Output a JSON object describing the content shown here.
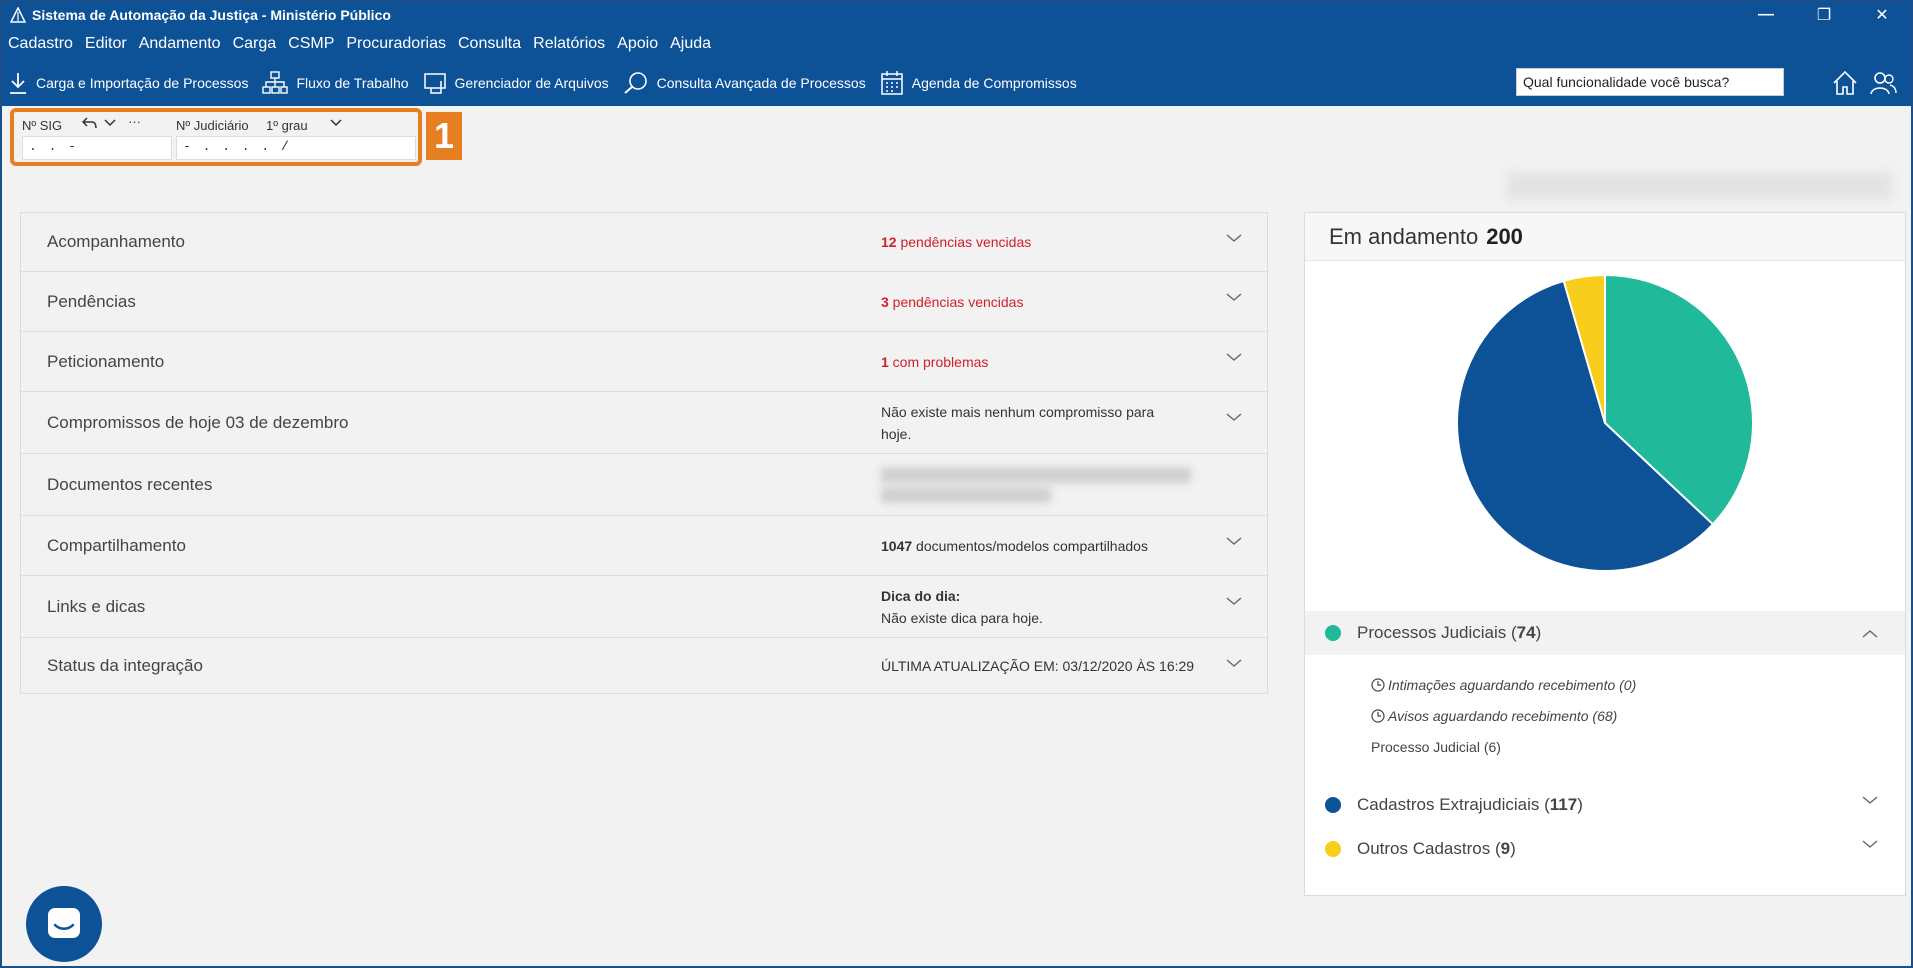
{
  "window": {
    "title": "Sistema de Automação da Justiça - Ministério Público",
    "controls": [
      "minimize",
      "restore",
      "close"
    ]
  },
  "menu": [
    "Cadastro",
    "Editor",
    "Andamento",
    "Carga",
    "CSMP",
    "Procuradorias",
    "Consulta",
    "Relatórios",
    "Apoio",
    "Ajuda"
  ],
  "toolbar": {
    "items": [
      {
        "label": "Carga e Importação de Processos",
        "icon": "download-icon"
      },
      {
        "label": "Fluxo de Trabalho",
        "icon": "workflow-icon"
      },
      {
        "label": "Gerenciador de Arquivos",
        "icon": "file-manager-icon"
      },
      {
        "label": "Consulta Avançada de Processos",
        "icon": "search-advanced-icon"
      },
      {
        "label": "Agenda de Compromissos",
        "icon": "calendar-icon"
      }
    ],
    "search_value": "Qual funcionalidade você busca?"
  },
  "process_fields": {
    "sig_label": "Nº SIG",
    "sig_mask": ".  .      -",
    "judicial_label": "Nº Judiciário",
    "grau": "1º grau",
    "judicial_mask": "-  .     .  .  .  /",
    "ellipsis": "···",
    "callout": "1"
  },
  "accordion": [
    {
      "title": "Acompanhamento",
      "count": "12",
      "info": " pendências vencidas",
      "type": "red"
    },
    {
      "title": "Pendências",
      "count": "3",
      "info": " pendências vencidas",
      "type": "red"
    },
    {
      "title": "Peticionamento",
      "count": "1",
      "info": " com problemas",
      "type": "red"
    },
    {
      "title": "Compromissos de hoje 03 de dezembro",
      "info": "Não existe mais nenhum compromisso para hoje.",
      "type": "plain"
    },
    {
      "title": "Documentos recentes",
      "type": "blurred"
    },
    {
      "title": "Compartilhamento",
      "count": "1047",
      "info": " documentos/modelos compartilhados",
      "type": "bold-count"
    },
    {
      "title": "Links e dicas",
      "heading": "Dica do dia:",
      "info": "Não existe dica para hoje.",
      "type": "tip"
    },
    {
      "title": "Status da integração",
      "info": "ÚLTIMA ATUALIZAÇÃO EM: 03/12/2020 ÀS 16:29",
      "type": "plain"
    }
  ],
  "panel": {
    "title": "Em andamento",
    "total": "200",
    "legend": [
      {
        "label": "Processos Judiciais (",
        "value": "74",
        "suffix": ")",
        "color": "#20b99a",
        "expanded": true
      },
      {
        "label": "Cadastros Extrajudiciais (",
        "value": "117",
        "suffix": ")",
        "color": "#0d5196",
        "expanded": false
      },
      {
        "label": "Outros Cadastros (",
        "value": "9",
        "suffix": ")",
        "color": "#f9cd1b",
        "expanded": false
      }
    ],
    "sub_items": [
      "Intimações aguardando recebimento (0)",
      "Avisos aguardando recebimento (68)",
      "Processo Judicial (6)"
    ]
  },
  "chart_data": {
    "type": "pie",
    "categories": [
      "Processos Judiciais",
      "Cadastros Extrajudiciais",
      "Outros Cadastros"
    ],
    "values": [
      74,
      117,
      9
    ],
    "colors": [
      "#20b99a",
      "#0d5196",
      "#f9cd1b"
    ]
  },
  "colors": {
    "brand": "#0d5196",
    "highlight": "#e67e22",
    "alert": "#d0202e"
  }
}
